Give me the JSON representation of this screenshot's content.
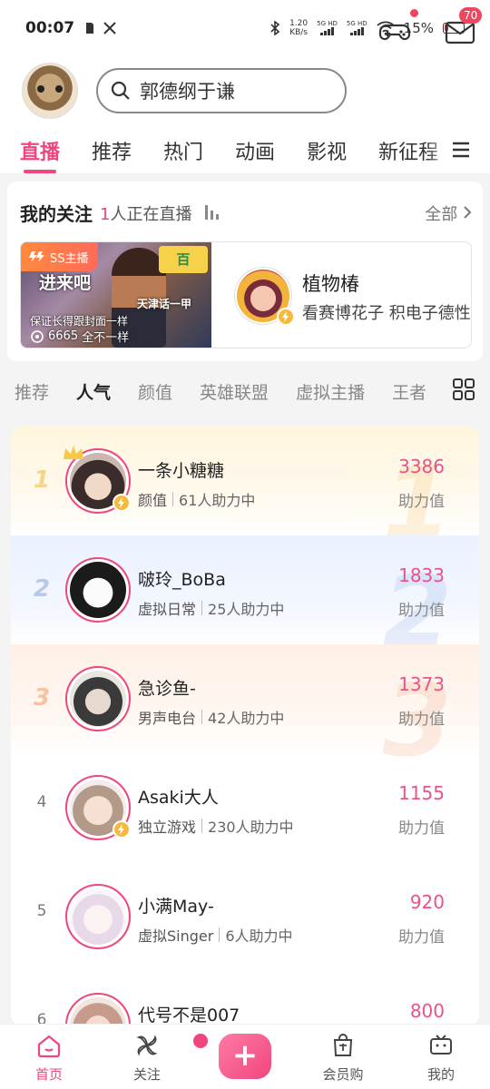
{
  "status_bar": {
    "time": "00:07",
    "speed_top": "1.20",
    "speed_unit": "KB/s",
    "sim1": "5G HD",
    "sim2": "5G HD",
    "battery": "15%"
  },
  "header": {
    "search_text": "郭德纲于谦",
    "mail_badge": "70"
  },
  "main_tabs": [
    "直播",
    "推荐",
    "热门",
    "动画",
    "影视",
    "新征程"
  ],
  "follow": {
    "title": "我的关注",
    "live_count": "1",
    "live_suffix": "人正在直播",
    "all_label": "全部",
    "stream": {
      "badge": "SS主播",
      "thumb_title": "进来吧",
      "thumb_sub": "保证长得跟封面一样",
      "thumb_sub2": "全不一样",
      "views": "6665",
      "thumb_side": "天津话一甲",
      "thumb_corner": "百",
      "name": "植物椿",
      "desc": "看赛博花子 积电子德性"
    }
  },
  "category_tabs": [
    "推荐",
    "人气",
    "颜值",
    "英雄联盟",
    "虚拟主播",
    "王者"
  ],
  "ranking": [
    {
      "rank": "1",
      "name": "一条小糖糖",
      "category": "颜值",
      "helpers": "61人助力中",
      "score": "3386",
      "score_label": "助力值"
    },
    {
      "rank": "2",
      "name": "啵玲_BoBa",
      "category": "虚拟日常",
      "helpers": "25人助力中",
      "score": "1833",
      "score_label": "助力值"
    },
    {
      "rank": "3",
      "name": "急诊鱼-",
      "category": "男声电台",
      "helpers": "42人助力中",
      "score": "1373",
      "score_label": "助力值"
    },
    {
      "rank": "4",
      "name": "Asaki大人",
      "category": "独立游戏",
      "helpers": "230人助力中",
      "score": "1155",
      "score_label": "助力值"
    },
    {
      "rank": "5",
      "name": "小满May-",
      "category": "虚拟Singer",
      "helpers": "6人助力中",
      "score": "920",
      "score_label": "助力值"
    },
    {
      "rank": "6",
      "name": "代号不是007_",
      "category": "",
      "helpers": "",
      "score": "800",
      "score_label": ""
    }
  ],
  "bottom_nav": {
    "home": "首页",
    "follow": "关注",
    "vip_shop": "会员购",
    "mine": "我的"
  },
  "colors": {
    "accent": "#f0467d",
    "score": "#e9528a"
  }
}
